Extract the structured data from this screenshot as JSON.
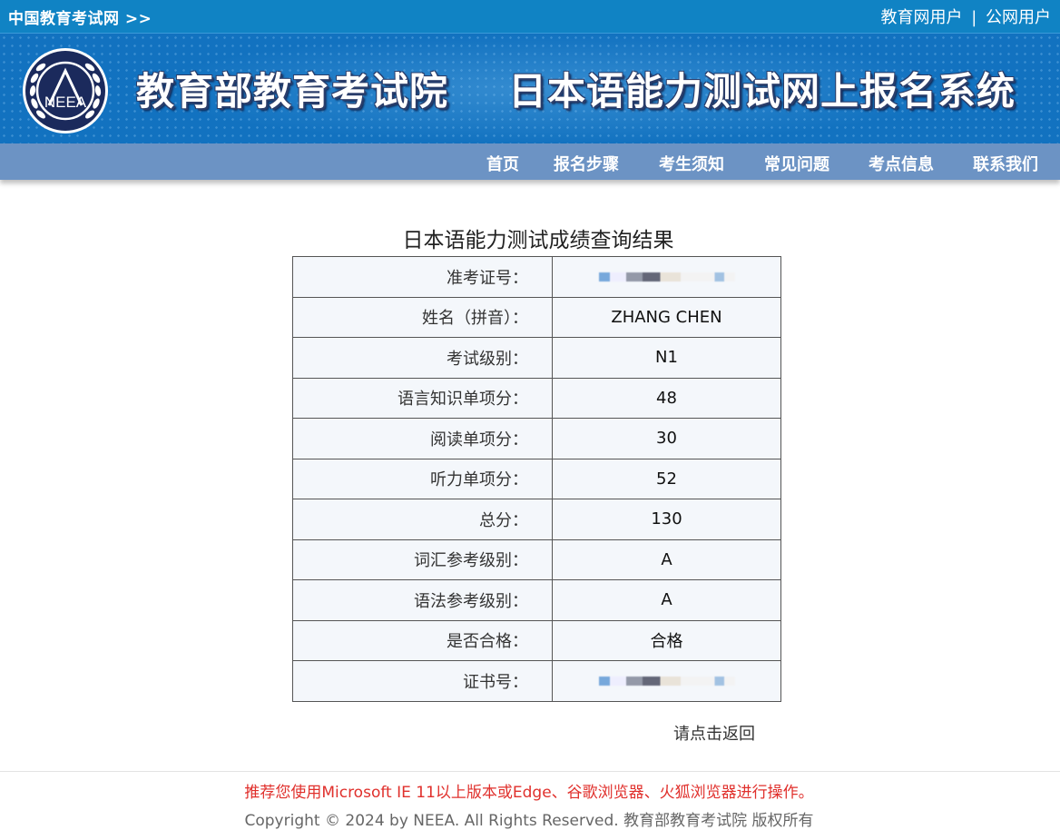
{
  "topbar": {
    "site_link": "中国教育考试网 >>",
    "user_links": [
      "教育网用户",
      "公网用户"
    ],
    "separator": "|"
  },
  "banner": {
    "logo_text": "NEEA",
    "title_left": "教育部教育考试院",
    "title_right": "日本语能力测试网上报名系统"
  },
  "nav": {
    "items": [
      "首页",
      "报名步骤",
      "考生须知",
      "常见问题",
      "考点信息",
      "联系我们"
    ]
  },
  "result": {
    "title": "日本语能力测试成绩查询结果",
    "rows": [
      {
        "label": "准考证号：",
        "value": ""
      },
      {
        "label": "姓名（拼音）：",
        "value": "ZHANG CHEN"
      },
      {
        "label": "考试级别：",
        "value": "N1"
      },
      {
        "label": "语言知识单项分：",
        "value": "48"
      },
      {
        "label": "阅读单项分：",
        "value": "30"
      },
      {
        "label": "听力单项分：",
        "value": "52"
      },
      {
        "label": "总分：",
        "value": "130"
      },
      {
        "label": "词汇参考级别：",
        "value": "A"
      },
      {
        "label": "语法参考级别：",
        "value": "A"
      },
      {
        "label": "是否合格：",
        "value": "合格"
      },
      {
        "label": "证书号：",
        "value": ""
      }
    ],
    "return_link": "请点击返回"
  },
  "footer": {
    "notice": "推荐您使用Microsoft IE 11以上版本或Edge、谷歌浏览器、火狐浏览器进行操作。",
    "copyright": "Copyright © 2024 by NEEA. All Rights Reserved. 教育部教育考试院 版权所有"
  },
  "colors": {
    "topbar": "#1083c4",
    "banner": "#1272c0",
    "nav": "#6c93c4",
    "notice": "#e0302c"
  }
}
